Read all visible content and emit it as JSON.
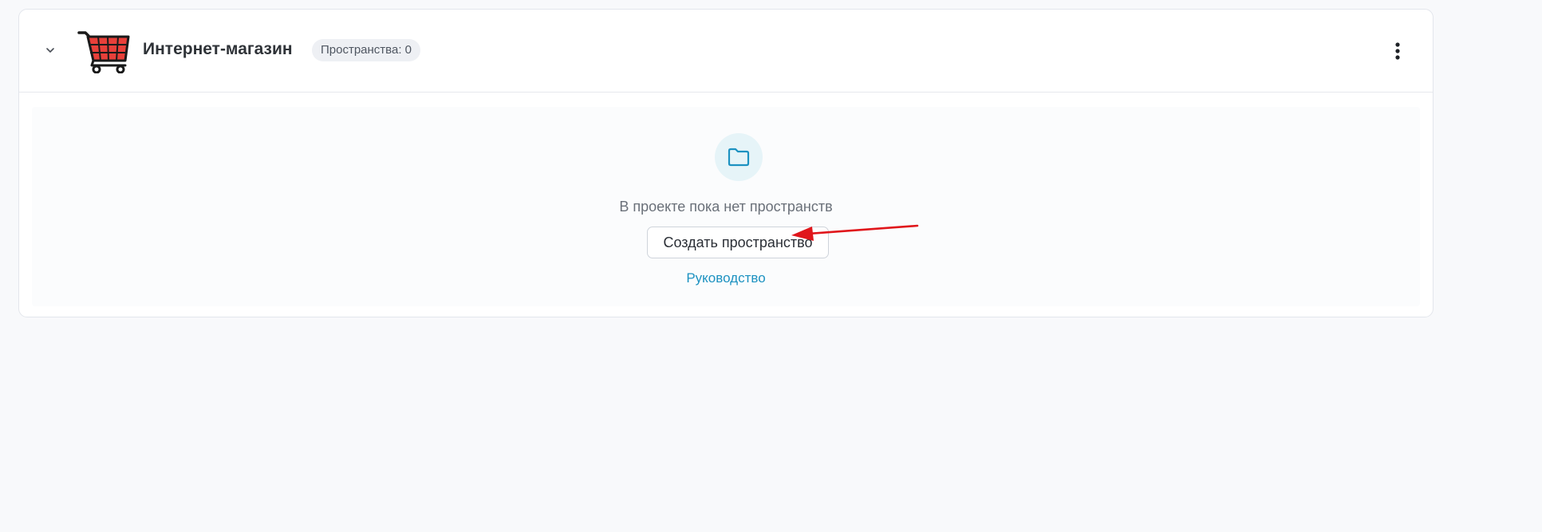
{
  "project": {
    "title": "Интернет-магазин",
    "spaces_badge": "Пространства: 0",
    "collapse_icon": "chevron-down-icon",
    "logo_icon": "shopping-cart-icon",
    "menu_icon": "kebab-menu-icon"
  },
  "empty_state": {
    "icon": "folder-icon",
    "message": "В проекте пока нет пространств",
    "create_button_label": "Создать пространство",
    "guide_link_label": "Руководство"
  },
  "annotation": {
    "arrow_color": "#e0161b"
  },
  "colors": {
    "accent": "#1d92c1",
    "folder_circle": "#e6f4f8",
    "badge_background": "#eef0f4"
  }
}
